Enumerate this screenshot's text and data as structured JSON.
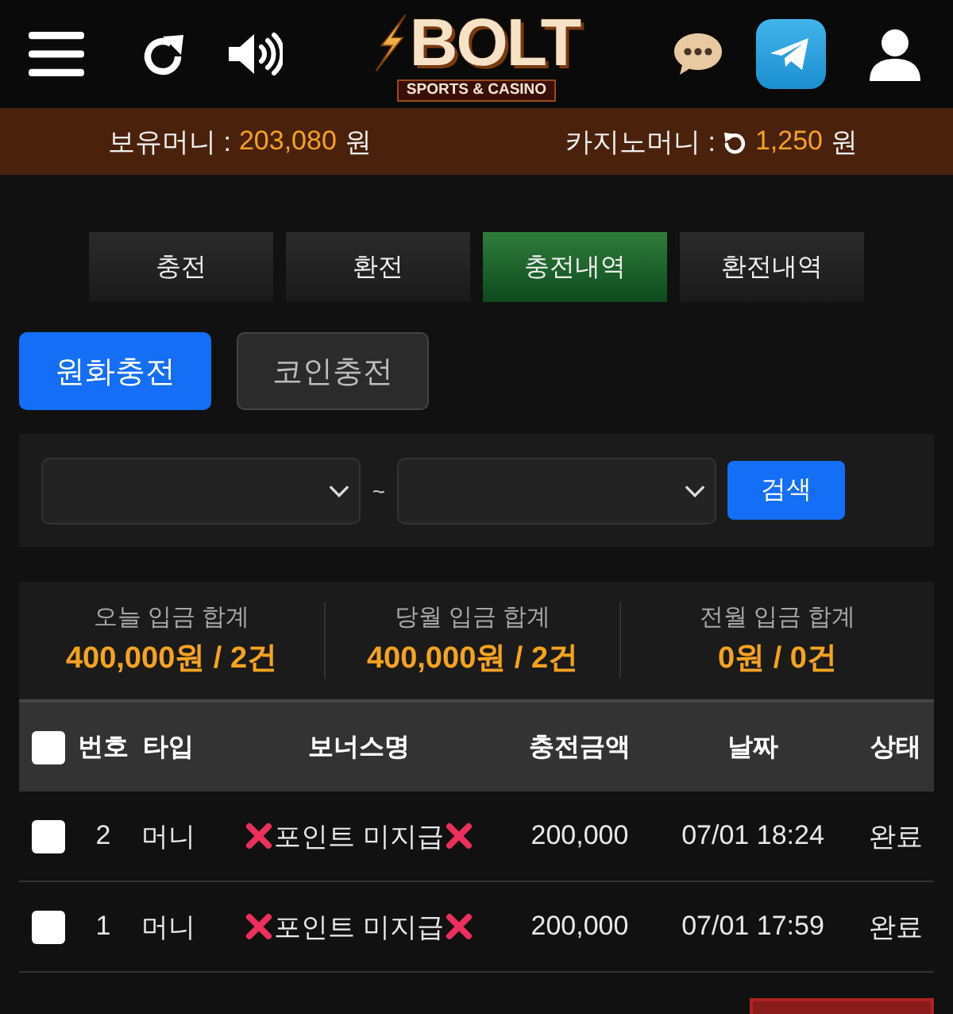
{
  "header": {
    "logo": {
      "title": "BOLT",
      "tagline": "SPORTS & CASINO"
    }
  },
  "balances": [
    {
      "label": "보유머니 :",
      "value": "203,080",
      "unit": "원",
      "refresh": false
    },
    {
      "label": "카지노머니 :",
      "value": "1,250",
      "unit": "원",
      "refresh": true
    }
  ],
  "tabs": [
    {
      "label": "충전",
      "selected": false
    },
    {
      "label": "환전",
      "selected": false
    },
    {
      "label": "충전내역",
      "selected": true
    },
    {
      "label": "환전내역",
      "selected": false
    }
  ],
  "deposit_types": [
    {
      "label": "원화충전",
      "selected": true
    },
    {
      "label": "코인충전",
      "selected": false
    }
  ],
  "search": {
    "separator": "~",
    "button": "검색"
  },
  "totals": [
    {
      "label": "오늘 입금 합계",
      "value": "400,000원 / 2건"
    },
    {
      "label": "당월 입금 합계",
      "value": "400,000원 / 2건"
    },
    {
      "label": "전월 입금 합계",
      "value": "0원 / 0건"
    }
  ],
  "table": {
    "select_all": {
      "checked": false
    },
    "columns": [
      "번호",
      "타입",
      "보너스명",
      "충전금액",
      "날짜",
      "상태"
    ],
    "rows": [
      {
        "checked": false,
        "no": "2",
        "type": "머니",
        "bonus": "포인트 미지급",
        "amount": "200,000",
        "date": "07/01 18:24",
        "status": "완료"
      },
      {
        "checked": false,
        "no": "1",
        "type": "머니",
        "bonus": "포인트 미지급",
        "amount": "200,000",
        "date": "07/01 17:59",
        "status": "완료"
      }
    ]
  }
}
